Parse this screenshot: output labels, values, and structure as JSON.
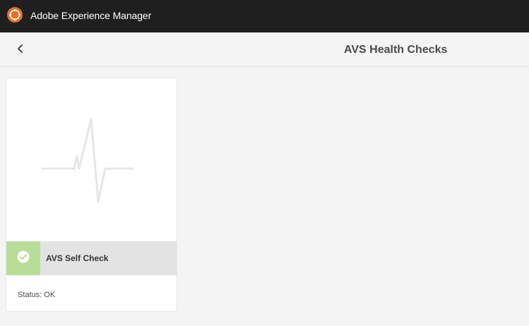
{
  "app": {
    "title": "Adobe Experience Manager",
    "logo_icon": "aem-logo-icon"
  },
  "header": {
    "back_icon": "chevron-left-icon",
    "title": "AVS Health Checks"
  },
  "cards": [
    {
      "thumbnail_icon": "heartbeat-pulse-icon",
      "status_icon": "check-circle-icon",
      "status_color": "#b7dd97",
      "title": "AVS Self Check",
      "status_text": "Status: OK"
    }
  ],
  "colors": {
    "topbar": "#1f1f1f",
    "page_background": "#f4f4f4",
    "card_titlebar": "#e3e3e3",
    "ok_green": "#b7dd97"
  }
}
